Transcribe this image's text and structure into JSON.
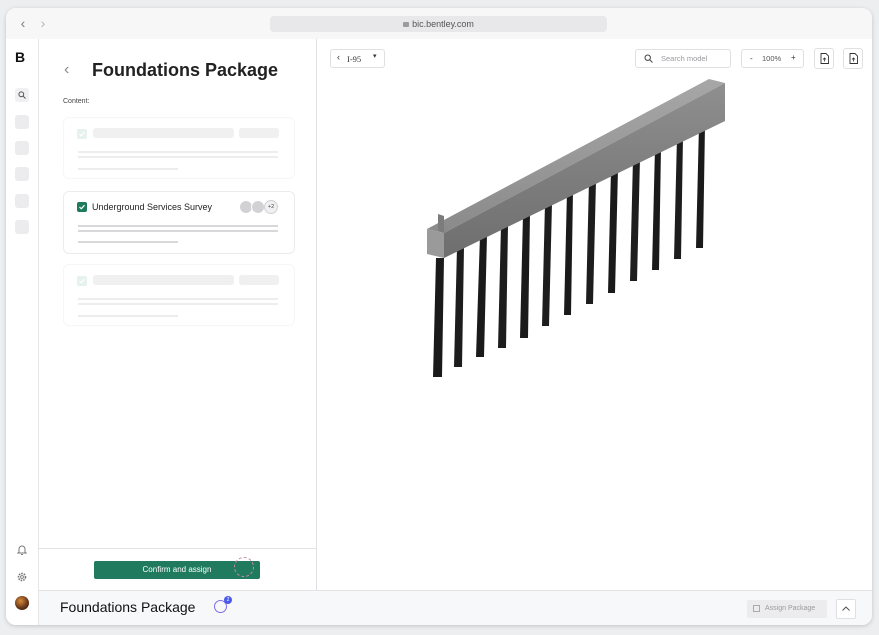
{
  "browser": {
    "url": "bic.bentley.com",
    "back_icon": "chevron-left-icon",
    "forward_icon": "chevron-right-icon"
  },
  "rail": {
    "logo": "B"
  },
  "panel": {
    "title": "Foundations Package",
    "content_label": "Content:",
    "cards": [
      {
        "name": "",
        "checked": true,
        "placeholder": true
      },
      {
        "name": "Underground Services Survey",
        "checked": true,
        "placeholder": false,
        "extra_assignees": "+2"
      },
      {
        "name": "",
        "checked": true,
        "placeholder": true
      }
    ],
    "confirm_label": "Confirm and assign"
  },
  "viewer": {
    "model_selector": "I-95",
    "search_placeholder": "Search model",
    "zoom_minus": "-",
    "zoom_level": "100%",
    "zoom_plus": "+"
  },
  "bottom": {
    "package_title": "Foundations Package",
    "badge_count": "2",
    "assign_label": "Assign Package"
  },
  "colors": {
    "accent": "#1f7a5e",
    "badge": "#4a5ae8"
  }
}
